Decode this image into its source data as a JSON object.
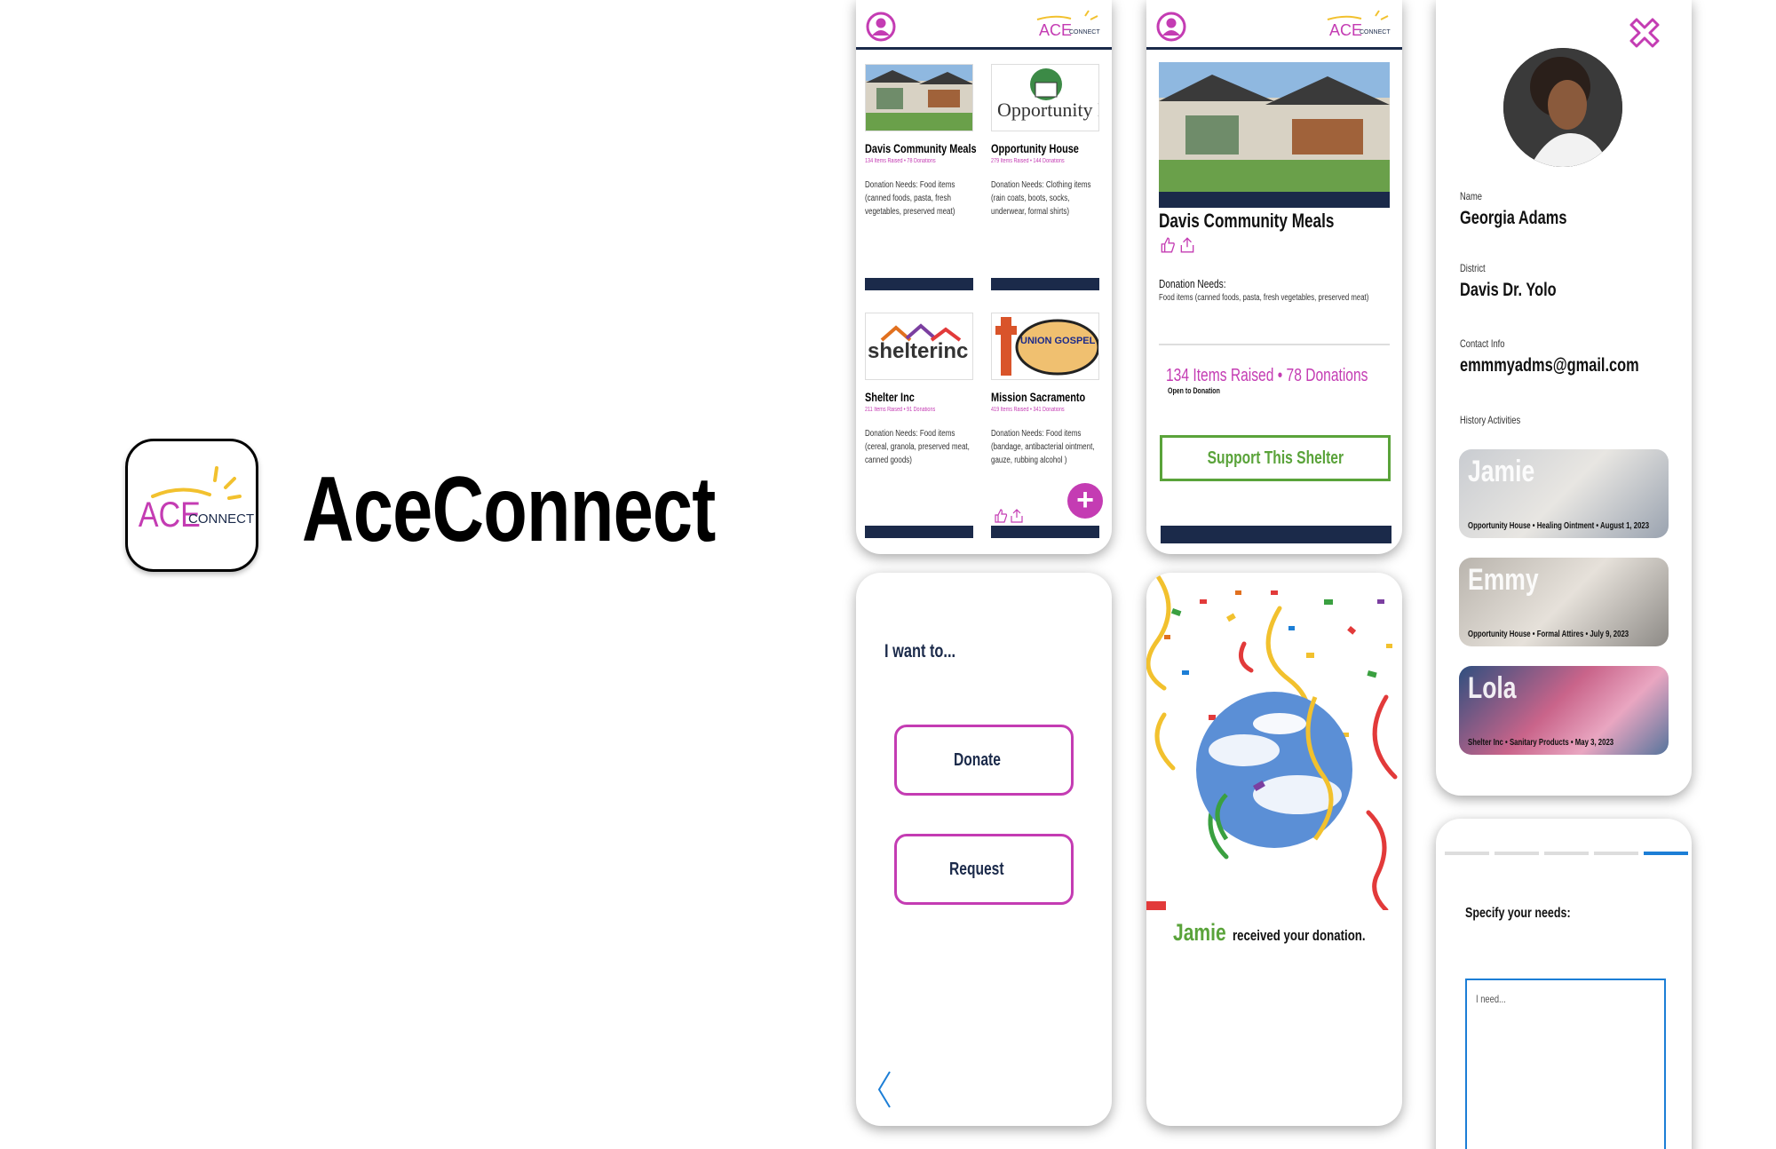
{
  "brand": {
    "app_name": "AceConnect",
    "logo_ace": "ACE",
    "logo_connect": "CONNECT"
  },
  "colors": {
    "accent_pink": "#c43cb3",
    "navy": "#1b2a4a",
    "green": "#5aa33a",
    "blue": "#1c7ed6",
    "logo_yellow": "#f2c12e"
  },
  "feed": {
    "cards": [
      {
        "name": "Davis Community Meals",
        "stats": "134 Items Raised • 78 Donations",
        "needs": "Donation Needs: Food items (canned foods, pasta, fresh vegetables, preserved meat)"
      },
      {
        "name": "Opportunity House",
        "stats": "279 Items Raised • 144 Donations",
        "needs": "Donation Needs: Clothing items (rain coats, boots, socks, underwear, formal shirts)",
        "logo_text": "Opportunity House"
      },
      {
        "name": "Shelter Inc",
        "stats": "211 Items Raised • 91 Donations",
        "needs": "Donation Needs: Food items (cereal, granola, preserved meat, canned goods)",
        "logo_text": "shelterinc"
      },
      {
        "name": "Mission Sacramento",
        "stats": "419 Items Raised • 341 Donations",
        "needs": "Donation Needs: Food items (bandage, antibacterial ointment, gauze, rubbing alcohol )",
        "logo_text": "UNION GOSPEL MISSION"
      }
    ],
    "fab_label": "+"
  },
  "detail": {
    "title": "Davis Community Meals",
    "needs_label": "Donation Needs:",
    "needs_text": "Food items (canned foods, pasta, fresh vegetables, preserved meat)",
    "raised": "134 Items Raised • 78 Donations",
    "open_label": "Open to Donation",
    "support_button": "Support This Shelter"
  },
  "profile": {
    "name_label": "Name",
    "name_value": "Georgia Adams",
    "district_label": "District",
    "district_value": "Davis Dr. Yolo",
    "contact_label": "Contact Info",
    "contact_value": "emmmyadms@gmail.com",
    "history_label": "History Activities",
    "history": [
      {
        "name": "Jamie",
        "caption": "Opportunity House • Healing Ointment • August 1, 2023"
      },
      {
        "name": "Emmy",
        "caption": "Opportunity House • Formal Attires • July 9, 2023"
      },
      {
        "name": "Lola",
        "caption": "Shelter Inc • Sanitary Products • May 3, 2023"
      }
    ]
  },
  "choice": {
    "title": "I want to...",
    "donate": "Donate",
    "request": "Request"
  },
  "celebration": {
    "recipient": "Jamie",
    "message": "received your donation."
  },
  "request_form": {
    "title": "Specify your needs:",
    "placeholder": "I need...",
    "steps_total": 5,
    "steps_done": 5
  }
}
